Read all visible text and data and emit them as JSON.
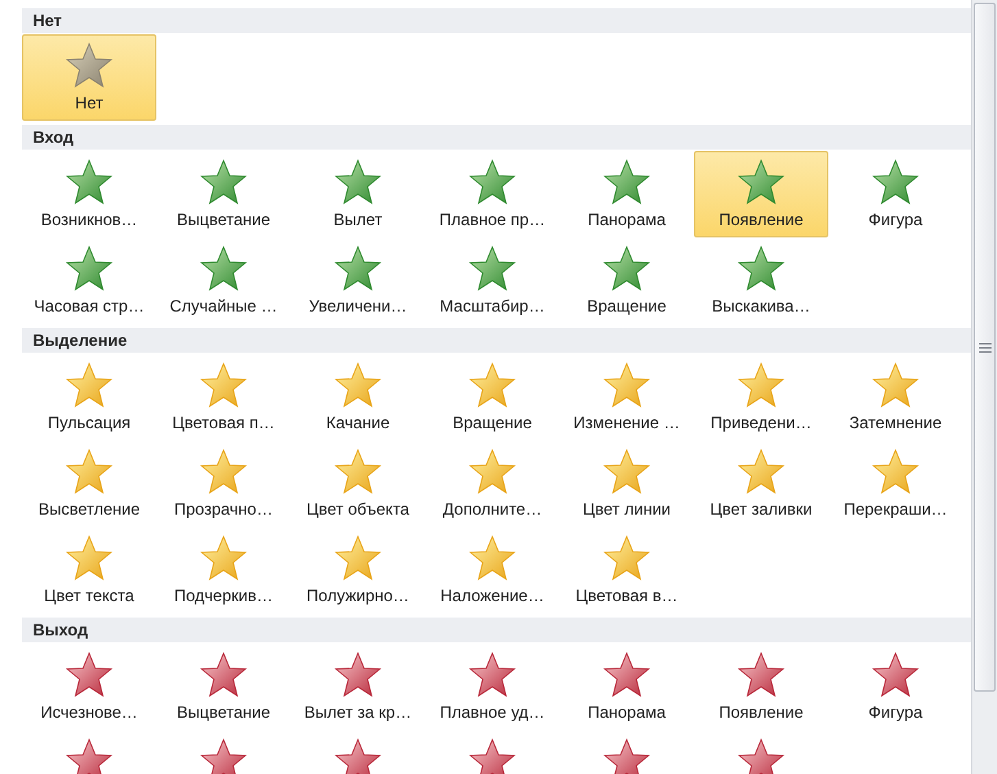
{
  "sections": [
    {
      "title": "Нет",
      "kind": "none",
      "items": [
        {
          "label": "Нет",
          "selected": true
        }
      ]
    },
    {
      "title": "Вход",
      "kind": "entrance",
      "items": [
        {
          "label": "Возникнов…",
          "selected": false
        },
        {
          "label": "Выцветание",
          "selected": false
        },
        {
          "label": "Вылет",
          "selected": false
        },
        {
          "label": "Плавное пр…",
          "selected": false
        },
        {
          "label": "Панорама",
          "selected": false
        },
        {
          "label": "Появление",
          "selected": true
        },
        {
          "label": "Фигура",
          "selected": false
        },
        {
          "label": "Часовая стр…",
          "selected": false
        },
        {
          "label": "Случайные …",
          "selected": false
        },
        {
          "label": "Увеличени…",
          "selected": false
        },
        {
          "label": "Масштабир…",
          "selected": false
        },
        {
          "label": "Вращение",
          "selected": false
        },
        {
          "label": "Выскакива…",
          "selected": false
        }
      ]
    },
    {
      "title": "Выделение",
      "kind": "emphasis",
      "items": [
        {
          "label": "Пульсация",
          "selected": false
        },
        {
          "label": "Цветовая п…",
          "selected": false
        },
        {
          "label": "Качание",
          "selected": false
        },
        {
          "label": "Вращение",
          "selected": false
        },
        {
          "label": "Изменение …",
          "selected": false
        },
        {
          "label": "Приведени…",
          "selected": false
        },
        {
          "label": "Затемнение",
          "selected": false
        },
        {
          "label": "Высветление",
          "selected": false
        },
        {
          "label": "Прозрачно…",
          "selected": false
        },
        {
          "label": "Цвет объекта",
          "selected": false
        },
        {
          "label": "Дополните…",
          "selected": false
        },
        {
          "label": "Цвет линии",
          "selected": false
        },
        {
          "label": "Цвет заливки",
          "selected": false
        },
        {
          "label": "Перекраши…",
          "selected": false
        },
        {
          "label": "Цвет текста",
          "selected": false
        },
        {
          "label": "Подчеркив…",
          "selected": false
        },
        {
          "label": "Полужирно…",
          "selected": false
        },
        {
          "label": "Наложение…",
          "selected": false
        },
        {
          "label": "Цветовая в…",
          "selected": false
        }
      ]
    },
    {
      "title": "Выход",
      "kind": "exit",
      "items": [
        {
          "label": "Исчезнове…",
          "selected": false
        },
        {
          "label": "Выцветание",
          "selected": false
        },
        {
          "label": "Вылет за кр…",
          "selected": false
        },
        {
          "label": "Плавное уд…",
          "selected": false
        },
        {
          "label": "Панорама",
          "selected": false
        },
        {
          "label": "Появление",
          "selected": false
        },
        {
          "label": "Фигура",
          "selected": false
        },
        {
          "selected": false
        },
        {
          "selected": false
        },
        {
          "selected": false
        },
        {
          "selected": false
        },
        {
          "selected": false
        },
        {
          "selected": false
        }
      ]
    }
  ]
}
